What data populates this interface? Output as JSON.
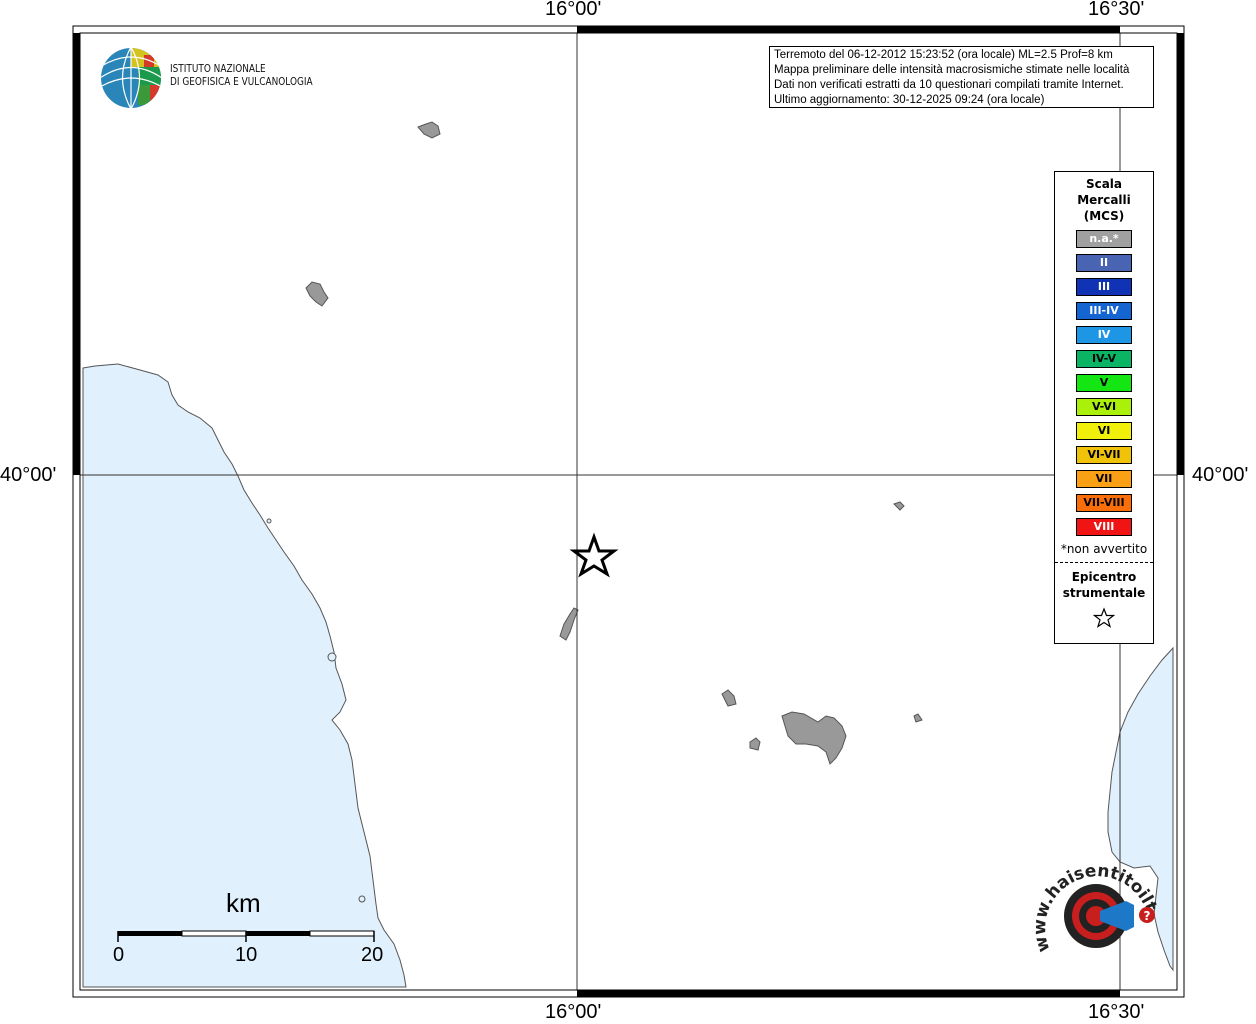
{
  "axes": {
    "top_left_lon": "16°00'",
    "top_right_lon": "16°30'",
    "bottom_left_lon": "16°00'",
    "bottom_right_lon": "16°30'",
    "left_lat": "40°00'",
    "right_lat": "40°00'"
  },
  "info": {
    "line1": "Terremoto del 06-12-2012 15:23:52 (ora locale) ML=2.5 Prof=8 km",
    "line2": "Mappa preliminare delle intensità macrosismiche stimate nelle località",
    "line3": "Dati non verificati estratti da 10 questionari compilati tramite Internet.",
    "line4": "Ultimo aggiornamento: 30-12-2025 09:24 (ora locale)"
  },
  "logo": {
    "line1": "ISTITUTO NAZIONALE",
    "line2": "DI GEOFISICA E VULCANOLOGIA"
  },
  "legend": {
    "title1": "Scala",
    "title2": "Mercalli",
    "title3": "(MCS)",
    "items": [
      {
        "label": "n.a.*",
        "color": "#a0a0a0",
        "text_color": "#ffffff"
      },
      {
        "label": "II",
        "color": "#4a64b4",
        "text_color": "#ffffff"
      },
      {
        "label": "III",
        "color": "#1032b4",
        "text_color": "#ffffff"
      },
      {
        "label": "III-IV",
        "color": "#1464d2",
        "text_color": "#ffffff"
      },
      {
        "label": "IV",
        "color": "#1e96e6",
        "text_color": "#ffffff"
      },
      {
        "label": "IV-V",
        "color": "#0ab464",
        "text_color": "#000000"
      },
      {
        "label": "V",
        "color": "#14e614",
        "text_color": "#000000"
      },
      {
        "label": "V-VI",
        "color": "#aaf00a",
        "text_color": "#000000"
      },
      {
        "label": "VI",
        "color": "#f0f00a",
        "text_color": "#000000"
      },
      {
        "label": "VI-VII",
        "color": "#f0c30a",
        "text_color": "#000000"
      },
      {
        "label": "VII",
        "color": "#faa014",
        "text_color": "#000000"
      },
      {
        "label": "VII-VIII",
        "color": "#fa6e0a",
        "text_color": "#000000"
      },
      {
        "label": "VIII",
        "color": "#f01414",
        "text_color": "#ffffff"
      }
    ],
    "note": "*non avvertito",
    "epi1": "Epicentro",
    "epi2": "strumentale"
  },
  "scale_bar": {
    "title": "km",
    "labels": [
      "0",
      "10",
      "20"
    ]
  },
  "hsit_logo": {
    "text": "www.haisentitoilterremoto.it"
  },
  "colors": {
    "sea": "#e0f0fc",
    "land_localities": "#999999",
    "frame": "#000000"
  }
}
